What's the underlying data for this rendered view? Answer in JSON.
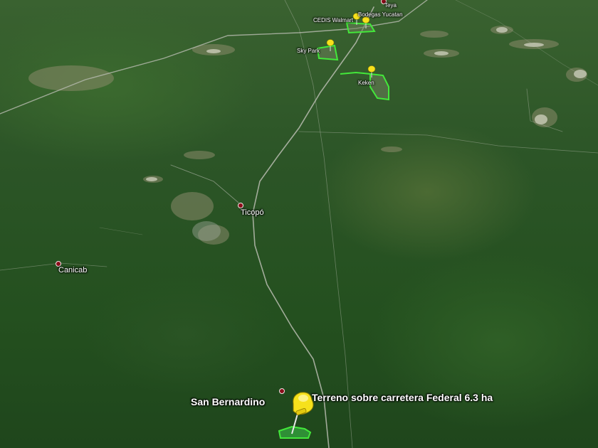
{
  "places": [
    {
      "id": "teya",
      "label": "Teya"
    },
    {
      "id": "cedis-walmart",
      "label": "CEDIS Walmart"
    },
    {
      "id": "bodegas-yucatan",
      "label": "Bodegas Yucatan"
    },
    {
      "id": "sky-park",
      "label": "Sky Park"
    },
    {
      "id": "keken",
      "label": "Keken"
    },
    {
      "id": "ticopo",
      "label": "Ticopó"
    },
    {
      "id": "canicab",
      "label": "Canicab"
    },
    {
      "id": "san-bernardino",
      "label": "San Bernardino"
    }
  ],
  "featured_property": {
    "label": "Terreno sobre carretera Federal 6.3 ha"
  },
  "colors": {
    "vegetation": "#2c5527",
    "parcel_outline": "#43e83a",
    "parcel_fill": "#2f8f36",
    "pushpin": "#f6e11c",
    "town_marker": "#8b0d1a",
    "road": "#b8bcb0"
  },
  "icons": {
    "pushpin": "yellow-pushpin-icon",
    "town_marker": "placemark-dot-icon"
  }
}
